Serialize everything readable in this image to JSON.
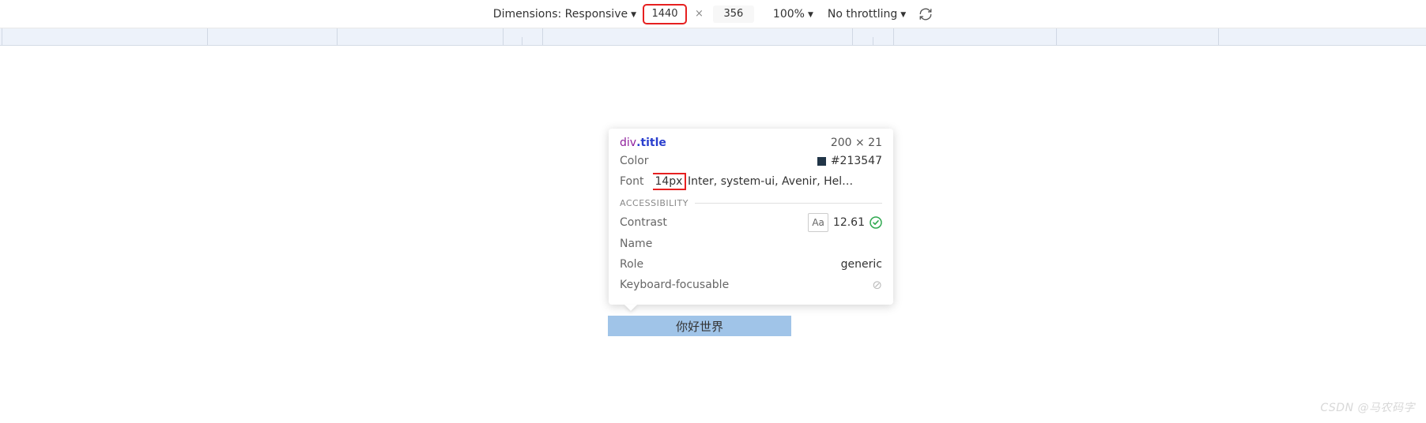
{
  "toolbar": {
    "dimensions_label": "Dimensions: Responsive",
    "width_value": "1440",
    "height_value": "356",
    "zoom_label": "100%",
    "throttling_label": "No throttling",
    "dim_separator": "×"
  },
  "tooltip": {
    "tag": "div",
    "class_name": ".title",
    "size": "200 × 21",
    "color_label": "Color",
    "color_value": "#213547",
    "font_label": "Font",
    "font_size": "14px",
    "font_family": "Inter, system-ui, Avenir, Helvetic...",
    "accessibility_heading": "ACCESSIBILITY",
    "contrast_label": "Contrast",
    "contrast_badge": "Aa",
    "contrast_value": "12.61",
    "name_label": "Name",
    "role_label": "Role",
    "role_value": "generic",
    "keyboard_label": "Keyboard-focusable"
  },
  "element": {
    "content": "你好世界"
  },
  "watermark": "CSDN @马农码字"
}
